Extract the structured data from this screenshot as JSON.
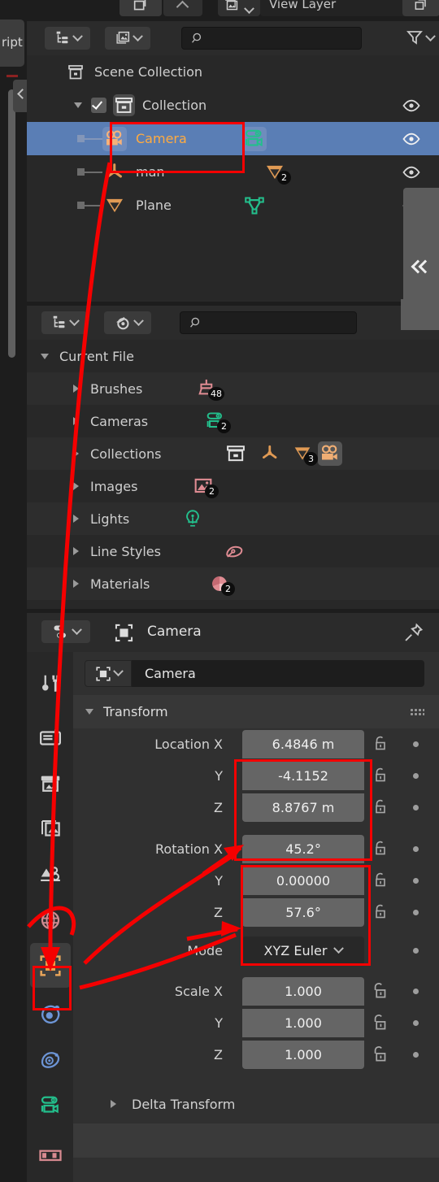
{
  "topbar": {
    "view_layer_label": "View Layer",
    "icons": [
      "scene-icon",
      "view-layer-icon",
      "new-scene-icon",
      "collapse-icon"
    ]
  },
  "workspace_tab_fragment": "ript",
  "outliner": {
    "header": {
      "display_mode_label": "View Layer",
      "filter_icon": "filter-icon",
      "display_mode_icon": "outliner-icon",
      "id_type_icon": "images-icon",
      "search_placeholder": ""
    },
    "rows": [
      {
        "label": "Scene Collection",
        "icon": "scene-collection-icon",
        "indent": 0,
        "selected": false,
        "expanded": false,
        "checkbox": false,
        "eye": false
      },
      {
        "label": "Collection",
        "icon": "collection-icon",
        "indent": 1,
        "selected": false,
        "expanded": true,
        "checkbox": true,
        "eye": true
      },
      {
        "label": "Camera",
        "icon": "camera-object-icon",
        "indent": 2,
        "selected": true,
        "expanded": false,
        "checkbox": false,
        "eye": true,
        "data_icon": "camera-data-icon"
      },
      {
        "label": "man",
        "icon": "armature-icon",
        "indent": 2,
        "selected": false,
        "expanded": false,
        "checkbox": false,
        "eye": true,
        "data_icon": "mesh-data-icon",
        "data_count": "2"
      },
      {
        "label": "Plane",
        "icon": "mesh-object-icon",
        "indent": 2,
        "selected": false,
        "expanded": false,
        "checkbox": false,
        "eye": true,
        "data_icon": "mesh-vert-icon"
      }
    ],
    "collapse_button": "«"
  },
  "blender_file_outliner": {
    "header": {
      "display_mode_icon": "outliner-icon",
      "id_type_icon": "blender-icon",
      "filter_icon": "filter-icon",
      "search_placeholder": ""
    },
    "root": "Current File",
    "rows": [
      {
        "label": "Brushes",
        "icon": "brush-icon",
        "count": "48"
      },
      {
        "label": "Cameras",
        "icon": "camera-data-icon",
        "count": "2"
      },
      {
        "label": "Collections",
        "icon": "collection-icon",
        "count": "3",
        "extra_icons": [
          "armature-icon",
          "mesh-data-icon",
          "camera-object-icon"
        ]
      },
      {
        "label": "Images",
        "icon": "image-icon",
        "count": "2"
      },
      {
        "label": "Lights",
        "icon": "light-icon",
        "count": ""
      },
      {
        "label": "Line Styles",
        "icon": "linestyle-icon",
        "count": ""
      },
      {
        "label": "Materials",
        "icon": "material-icon",
        "count": "2"
      }
    ]
  },
  "properties": {
    "header": {
      "editor_type_icon": "properties-editor-icon",
      "breadcrumb_icon": "object-properties-icon",
      "breadcrumb": "Camera",
      "pin_icon": "pin-icon"
    },
    "id_block": {
      "type_icon": "object-properties-icon",
      "name": "Camera"
    },
    "tabs": [
      {
        "name": "tool",
        "icon": "tool-icon",
        "active": false
      },
      {
        "name": "render",
        "icon": "render-icon",
        "active": false
      },
      {
        "name": "output",
        "icon": "output-icon",
        "active": false
      },
      {
        "name": "view-layer",
        "icon": "view-layer-icon",
        "active": false
      },
      {
        "name": "scene",
        "icon": "scene-icon",
        "active": false
      },
      {
        "name": "world",
        "icon": "world-icon",
        "active": false
      },
      {
        "name": "object",
        "icon": "object-properties-icon",
        "active": true
      },
      {
        "name": "modifiers",
        "icon": "modifier-icon",
        "active": false
      },
      {
        "name": "physics",
        "icon": "physics-icon",
        "active": false
      },
      {
        "name": "object-data",
        "icon": "camera-data-icon",
        "active": false
      },
      {
        "name": "material",
        "icon": "material-icon",
        "active": false
      }
    ],
    "panels": [
      {
        "title": "Transform",
        "expanded": true
      },
      {
        "title": "Delta Transform",
        "expanded": false
      }
    ],
    "transform": {
      "location": {
        "label": "Location X",
        "sub_labels": [
          "Y",
          "Z"
        ],
        "values": [
          "6.4846 m",
          "-4.1152",
          "8.8767 m"
        ]
      },
      "rotation": {
        "label": "Rotation X",
        "sub_labels": [
          "Y",
          "Z"
        ],
        "values": [
          "45.2°",
          "0.00000",
          "57.6°"
        ]
      },
      "mode": {
        "label": "Mode",
        "value": "XYZ Euler"
      },
      "scale": {
        "label": "Scale X",
        "sub_labels": [
          "Y",
          "Z"
        ],
        "values": [
          "1.000",
          "1.000",
          "1.000"
        ]
      }
    }
  },
  "annotations": {
    "color": "#f50000",
    "boxes": [
      {
        "name": "camera-outliner-highlight"
      },
      {
        "name": "object-properties-tab-highlight"
      },
      {
        "name": "location-fields-highlight"
      },
      {
        "name": "rotation-fields-highlight"
      }
    ]
  },
  "colors": {
    "selection_blue": "#5a7eb5",
    "active_orange": "#ffab40",
    "annotation_red": "#f50000",
    "field_grey": "#656565",
    "panel_bg": "#303030",
    "editor_bg": "#282828"
  }
}
